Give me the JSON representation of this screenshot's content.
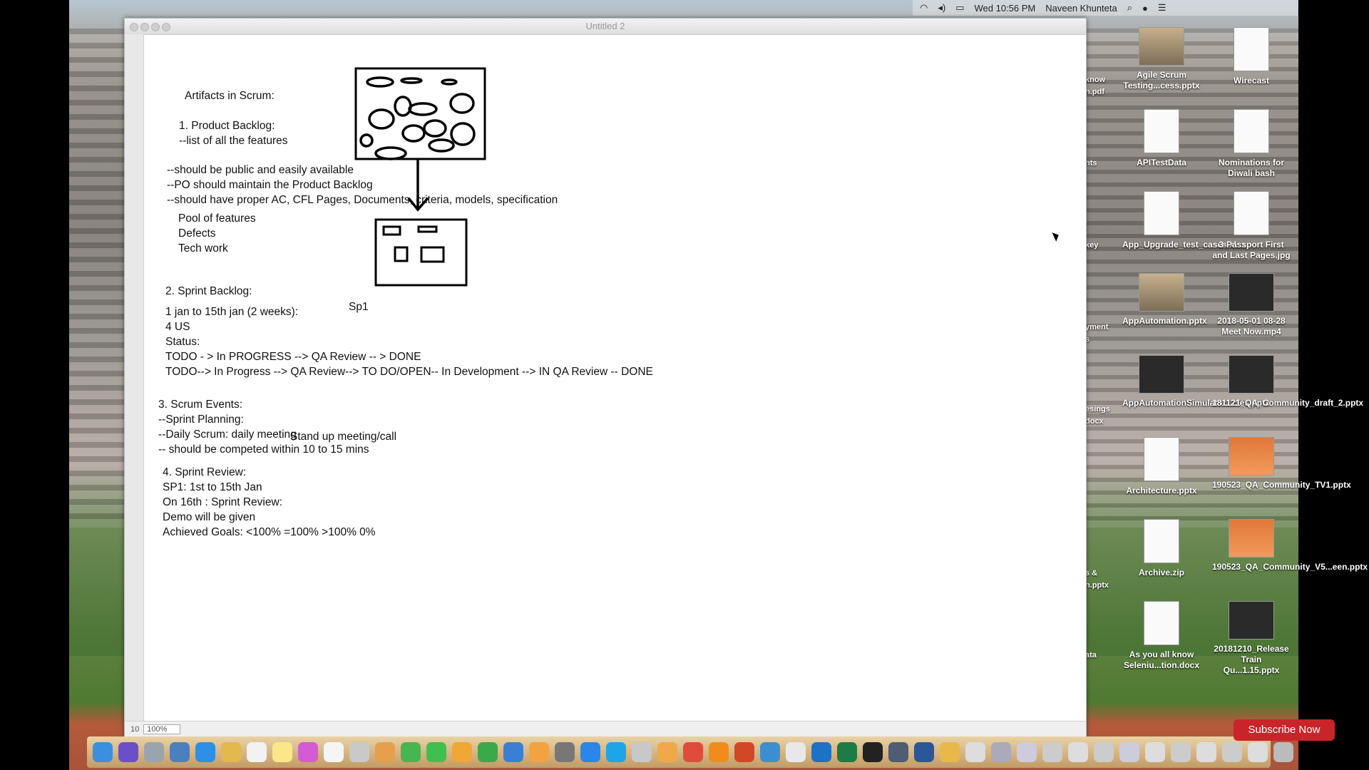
{
  "menubar": {
    "clock": "Wed 10:56 PM",
    "user": "Naveen Khunteta"
  },
  "window": {
    "title": "Untitled 2",
    "zoom": "100%",
    "page": "10"
  },
  "document": {
    "artifacts_title": "Artifacts in Scrum:",
    "pb_heading": "1. Product Backlog:",
    "pb_line1": "--list of all the features",
    "pb_line2": "--should be public and easily available",
    "pb_line3": "--PO should maintain the Product Backlog",
    "pb_line4": "--should have proper AC, CFL Pages, Documents, criteria, models, specification",
    "pool": "Pool of features",
    "defects": "Defects",
    "tech": "Tech work",
    "sp1": "Sp1",
    "sb_heading": "2. Sprint Backlog:",
    "sb_line1": "1 jan to 15th jan (2 weeks):",
    "sb_line2": "4 US",
    "sb_line3": "Status:",
    "sb_line4": "TODO - > In PROGRESS --> QA Review -- > DONE",
    "sb_line5": "TODO--> In Progress --> QA Review--> TO DO/OPEN--  In Development --> IN QA Review -- DONE",
    "se_heading": "3. Scrum Events:",
    "se_line1": "--Sprint Planning:",
    "se_line2": "--Daily Scrum: daily meeting",
    "se_line2b": "Stand up meeting/call",
    "se_line3": "-- should be competed within 10 to 15 mins",
    "sr_heading": "4. Sprint Review:",
    "sr_line1": "SP1: 1st to 15th Jan",
    "sr_line2": "On 16th : Sprint Review:",
    "sr_line3": "Demo will be given",
    "sr_line4": "Achieved Goals: <100% =100% >100% 0%"
  },
  "desktop_icons": [
    {
      "label": "Agile Scrum Testing...cess.pptx"
    },
    {
      "label": "Wirecast"
    },
    {
      "label": "APITestData"
    },
    {
      "label": "Nominations for Diwali bash"
    },
    {
      "label": "App_Upgrade_test_cases.xlsx"
    },
    {
      "label": "3-Passport First and Last Pages.jpg"
    },
    {
      "label": "AppAutomation.pptx"
    },
    {
      "label": "2018-05-01 08-28 Meet Now.mp4"
    },
    {
      "label": "AppAutomationSimulator...cles.pptx"
    },
    {
      "label": "181121_QA_Community_draft_2.pptx"
    },
    {
      "label": "Architecture.pptx"
    },
    {
      "label": "190523_QA_Community_TV1.pptx"
    },
    {
      "label": "Archive.zip"
    },
    {
      "label": "190523_QA_Community_V5...een.pptx"
    },
    {
      "label": "As you all know Seleniu...tion.docx"
    },
    {
      "label": "20181210_Release Train Qu...1.15.pptx"
    }
  ],
  "edge_labels": [
    "know",
    "n.pdf",
    "nts",
    "key",
    "yment",
    "s",
    "esings",
    "docx",
    "s &",
    "n.pptx",
    "ata"
  ],
  "subscribe": "Subscribe Now"
}
